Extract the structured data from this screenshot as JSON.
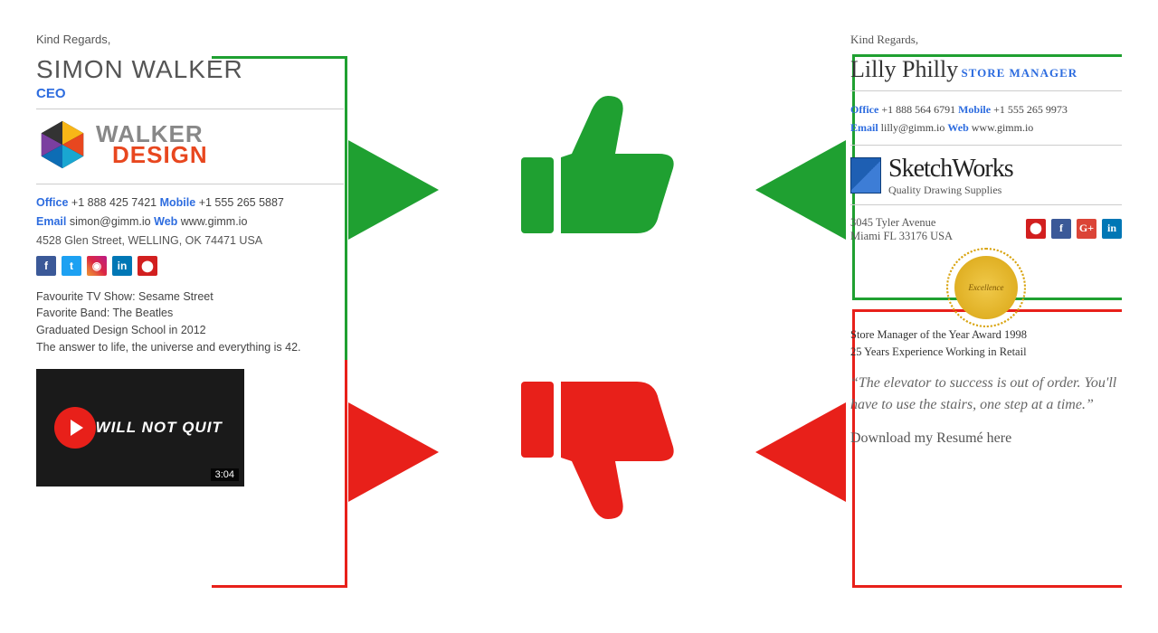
{
  "left": {
    "greeting": "Kind Regards,",
    "name": "SIMON WALKER",
    "title": "CEO",
    "company_line1": "WALKER",
    "company_line2": "DESIGN",
    "office_label": "Office",
    "office": "+1 888 425 7421",
    "mobile_label": "Mobile",
    "mobile": "+1 555 265 5887",
    "email_label": "Email",
    "email": "simon@gimm.io",
    "web_label": "Web",
    "web": "www.gimm.io",
    "address": "4528 Glen Street, WELLING, OK 74471 USA",
    "extras": [
      "Favourite TV Show: Sesame Street",
      "Favorite Band: The Beatles",
      "Graduated Design School in 2012",
      "The answer to life, the universe and everything is 42."
    ],
    "video_title": "I WILL NOT QUIT",
    "video_duration": "3:04"
  },
  "right": {
    "greeting": "Kind Regards,",
    "name": "Lilly Philly",
    "title": "STORE MANAGER",
    "office_label": "Office",
    "office": "+1 888 564 6791",
    "mobile_label": "Mobile",
    "mobile": "+1 555 265 9973",
    "email_label": "Email",
    "email": "lilly@gimm.io",
    "web_label": "Web",
    "web": "www.gimm.io",
    "company": "SketchWorks",
    "tagline": "Quality Drawing Supplies",
    "address1": "3045 Tyler Avenue",
    "address2": "Miami FL 33176 USA",
    "seal": "Excellence",
    "award1": "Store Manager of the Year Award 1998",
    "award2": "25 Years Experience Working in Retail",
    "quote": "“The elevator to success is out of order. You'll have to use the stairs, one step at a time.”",
    "download": "Download my Resumé here"
  }
}
